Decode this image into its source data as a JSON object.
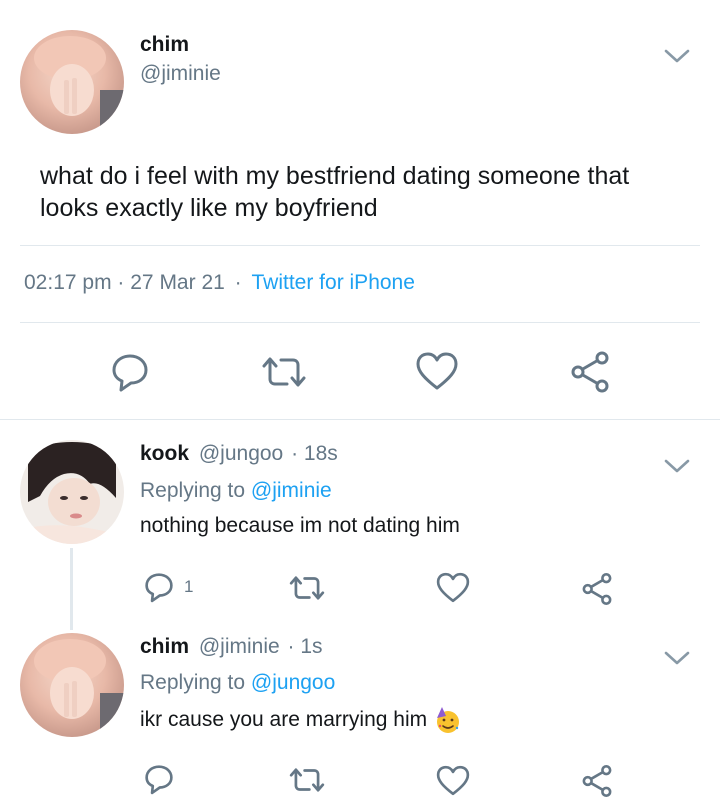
{
  "main_tweet": {
    "display_name": "chim",
    "handle": "@jiminie",
    "text_line1": "what do i feel with my bestfriend dating someone that",
    "text_line2": "looks exactly like my boyfriend",
    "time": "02:17 pm",
    "date": "27 Mar 21",
    "separator": "·",
    "source": "Twitter for iPhone",
    "actions": [
      "reply-icon",
      "retweet-icon",
      "like-icon",
      "share-icon"
    ]
  },
  "replies": [
    {
      "display_name": "kook",
      "handle": "@jungoo",
      "time": "· 18s",
      "replying_prefix": "Replying to",
      "replying_to": "@jiminie",
      "text": "nothing because im not dating him",
      "reply_count": "1"
    },
    {
      "display_name": "chim",
      "handle": "@jiminie",
      "time": "· 1s",
      "replying_prefix": "Replying to",
      "replying_to": "@jungoo",
      "text": "ikr cause you are marrying him",
      "emoji": "partying-face-icon"
    }
  ],
  "colors": {
    "accent": "#1da1f2",
    "icon_gray": "#657786",
    "divider": "#e1e8ed",
    "text": "#14171a"
  }
}
